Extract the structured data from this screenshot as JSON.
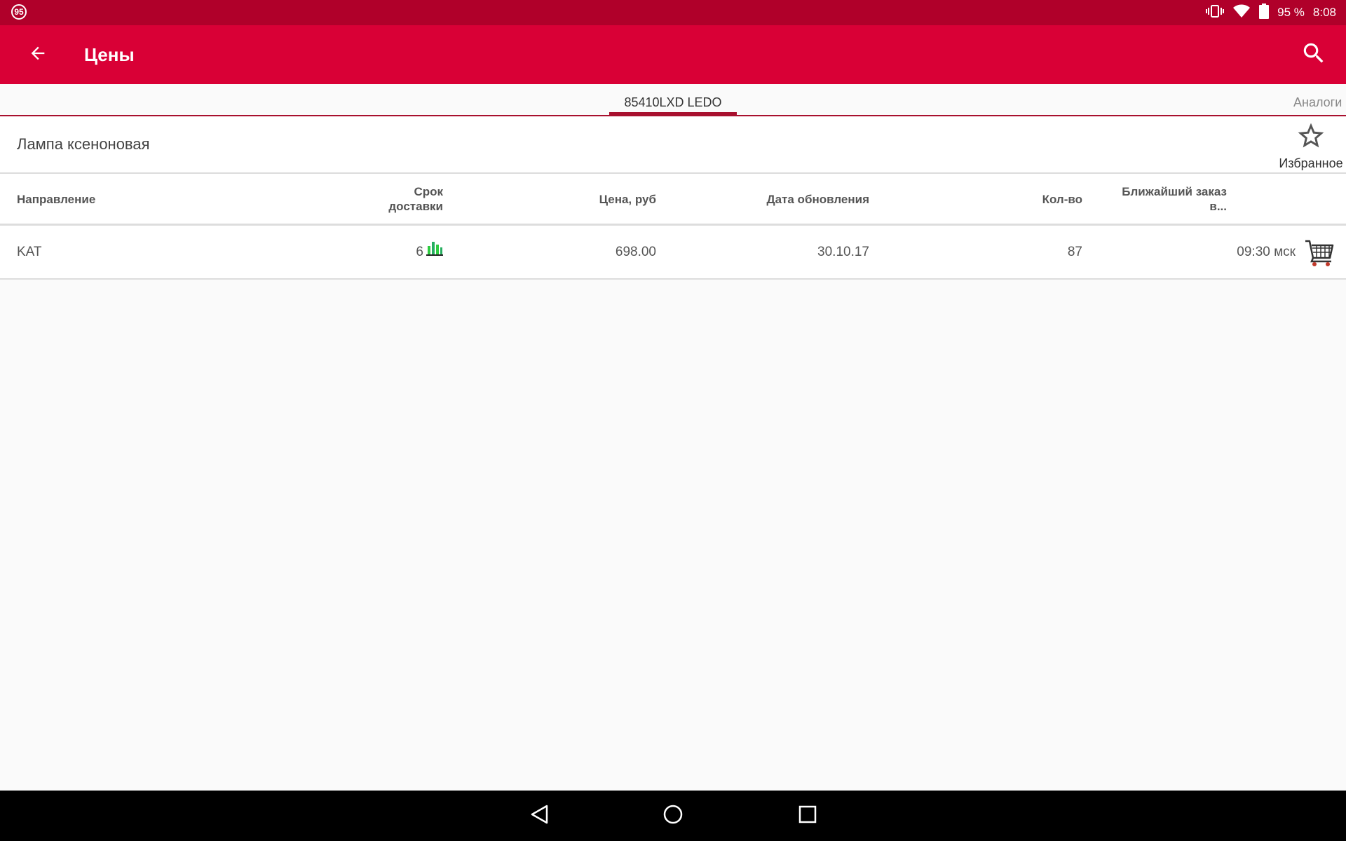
{
  "status_bar": {
    "notification_badge": "95",
    "battery_percent": "95 %",
    "time": "8:08",
    "icons": [
      "vibrate-icon",
      "wifi-icon",
      "battery-icon"
    ]
  },
  "app_bar": {
    "title": "Цены",
    "back_icon": "arrow-back-icon",
    "search_icon": "search-icon"
  },
  "tabs": [
    {
      "label": "85410LXD LEDO",
      "active": true
    },
    {
      "label": "Аналоги",
      "active": false
    }
  ],
  "product": {
    "name": "Лампа ксеноновая",
    "favorite_label": "Избранное"
  },
  "table": {
    "headers": {
      "direction": "Направление",
      "delivery": "Срок доставки",
      "price": "Цена, руб",
      "date": "Дата обновления",
      "qty": "Кол-во",
      "nearest": "Ближайший заказ в..."
    },
    "rows": [
      {
        "direction": "KAT",
        "delivery": "6",
        "price": "698.00",
        "date": "30.10.17",
        "qty": "87",
        "nearest": "09:30 мск"
      }
    ]
  },
  "nav_bar": {
    "icons": [
      "nav-back-icon",
      "nav-home-icon",
      "nav-recent-icon"
    ]
  },
  "colors": {
    "status_bar": "#b0002a",
    "app_bar": "#d90036",
    "tab_indicator": "#a8102e",
    "bars_icon": "#2ecc40"
  }
}
